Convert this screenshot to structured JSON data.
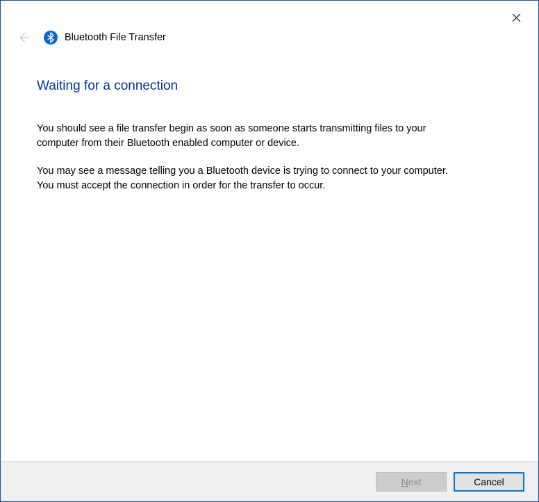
{
  "window": {
    "title": "Bluetooth File Transfer"
  },
  "content": {
    "heading": "Waiting for a connection",
    "paragraph1": "You should see a file transfer begin as soon as someone starts transmitting files to your computer from their Bluetooth enabled computer or device.",
    "paragraph2": "You may see a message telling you a Bluetooth device is trying to connect to your computer. You must accept the connection in order for the transfer to occur."
  },
  "buttons": {
    "next_prefix": "N",
    "next_suffix": "ext",
    "cancel": "Cancel"
  }
}
